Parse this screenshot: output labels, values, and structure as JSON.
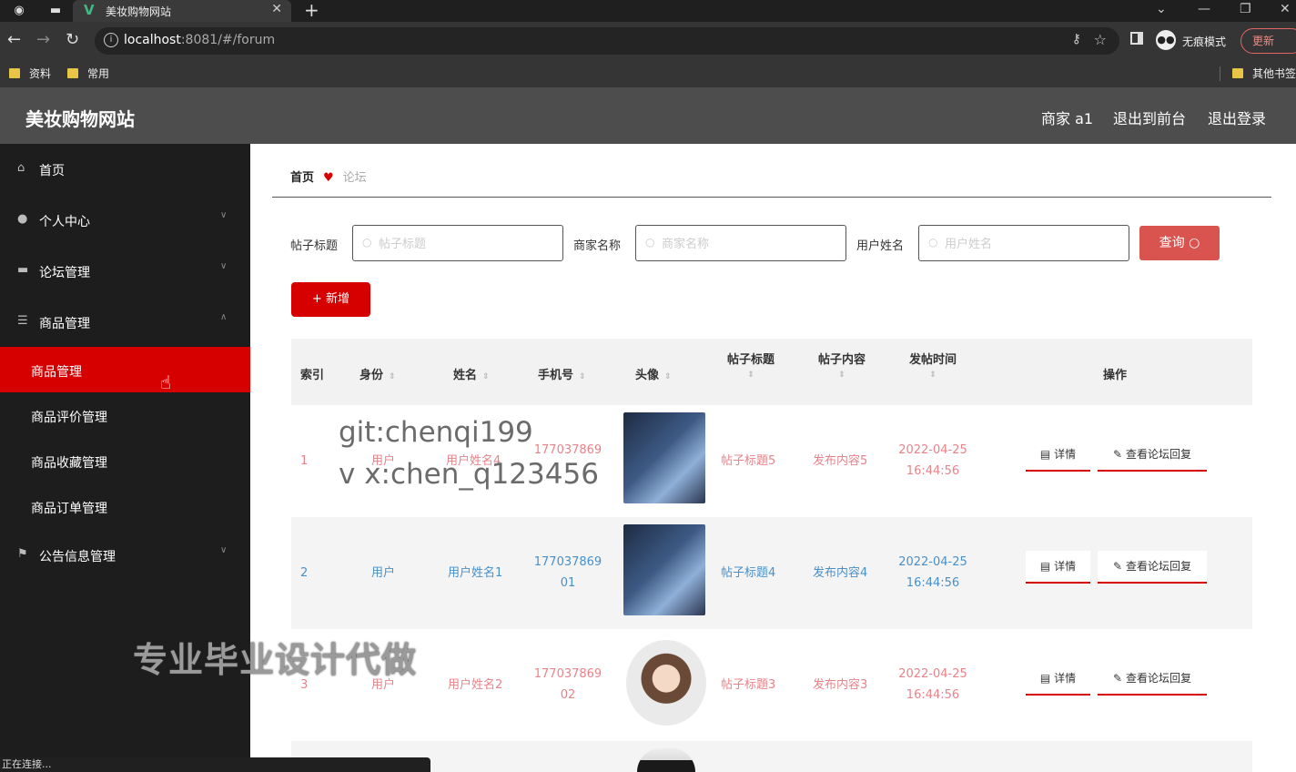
{
  "browser": {
    "tab_title": "美妆购物网站",
    "url_host": "localhost",
    "url_rest": ":8081/#/forum",
    "incognito_label": "无痕模式",
    "update_label": "更新",
    "bookmarks": [
      "资料",
      "常用"
    ],
    "other_bookmarks": "其他书签",
    "status_text": "正在连接..."
  },
  "header": {
    "title": "美妆购物网站",
    "user": "商家 a1",
    "back_to_front": "退出到前台",
    "logout": "退出登录"
  },
  "sidebar": {
    "items": [
      {
        "label": "首页",
        "icon": "home-icon"
      },
      {
        "label": "个人中心",
        "icon": "user-icon"
      },
      {
        "label": "论坛管理",
        "icon": "forum-icon"
      },
      {
        "label": "商品管理",
        "icon": "list-icon"
      }
    ],
    "sub_items": [
      "商品管理",
      "商品评价管理",
      "商品收藏管理",
      "商品订单管理"
    ],
    "last_item": {
      "label": "公告信息管理",
      "icon": "flag-icon"
    }
  },
  "breadcrumb": {
    "home": "首页",
    "current": "论坛"
  },
  "filters": {
    "title_label": "帖子标题",
    "title_placeholder": "帖子标题",
    "merchant_label": "商家名称",
    "merchant_placeholder": "商家名称",
    "user_label": "用户姓名",
    "user_placeholder": "用户姓名",
    "search_button": "查询",
    "add_button": "新增"
  },
  "table": {
    "columns": [
      "索引",
      "身份",
      "姓名",
      "手机号",
      "头像",
      "帖子标题",
      "帖子内容",
      "发帖时间",
      "操作"
    ],
    "rows": [
      {
        "index": "1",
        "role": "用户",
        "name": "用户姓名4",
        "phone1": "177037869",
        "phone2": "",
        "title": "帖子标题5",
        "content": "发布内容5",
        "date": "2022-04-25",
        "time": "16:44:56"
      },
      {
        "index": "2",
        "role": "用户",
        "name": "用户姓名1",
        "phone1": "177037869",
        "phone2": "01",
        "title": "帖子标题4",
        "content": "发布内容4",
        "date": "2022-04-25",
        "time": "16:44:56"
      },
      {
        "index": "3",
        "role": "用户",
        "name": "用户姓名2",
        "phone1": "177037869",
        "phone2": "02",
        "title": "帖子标题3",
        "content": "发布内容3",
        "date": "2022-04-25",
        "time": "16:44:56"
      }
    ],
    "detail_label": "详情",
    "reply_label": "查看论坛回复"
  },
  "colors": {
    "accent": "#d60000",
    "link_blue": "#4a90c8",
    "link_red": "#e8838a",
    "sidebar_bg": "#1d1d1d",
    "header_bg": "#4d4d4d"
  },
  "overlay": {
    "line1": "git:chenqi199",
    "line2": "v x:chen_q123456",
    "line3": "专业毕业设计代做"
  }
}
